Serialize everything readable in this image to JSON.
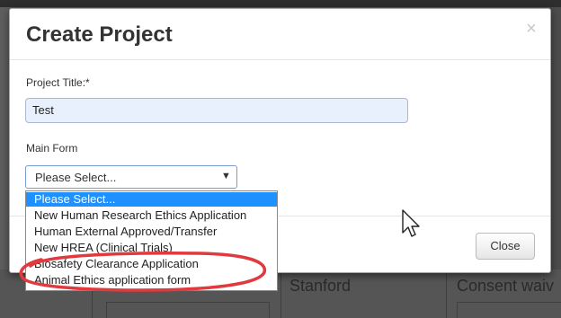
{
  "background": {
    "cells": [
      "Stanford",
      "Consent waiv"
    ]
  },
  "modal": {
    "title": "Create Project",
    "close_icon_glyph": "×",
    "project_title_label": "Project Title:*",
    "project_title_value": "Test",
    "main_form_label": "Main Form",
    "main_form_selected": "Please Select...",
    "select_arrow_glyph": "▼",
    "close_button_label": "Close"
  },
  "dropdown": {
    "options": [
      "Please Select...",
      "New Human Research Ethics Application",
      "Human External Approved/Transfer",
      "New HREA (Clinical Trials)",
      "Biosafety Clearance Application",
      "Animal Ethics application form"
    ],
    "selected_index": 0
  },
  "annotation": {
    "highlight_color": "#e0393e",
    "highlighted_option": "Biosafety Clearance Application"
  },
  "icons": [
    "close-icon",
    "chevron-down-icon",
    "mouse-cursor-icon"
  ]
}
